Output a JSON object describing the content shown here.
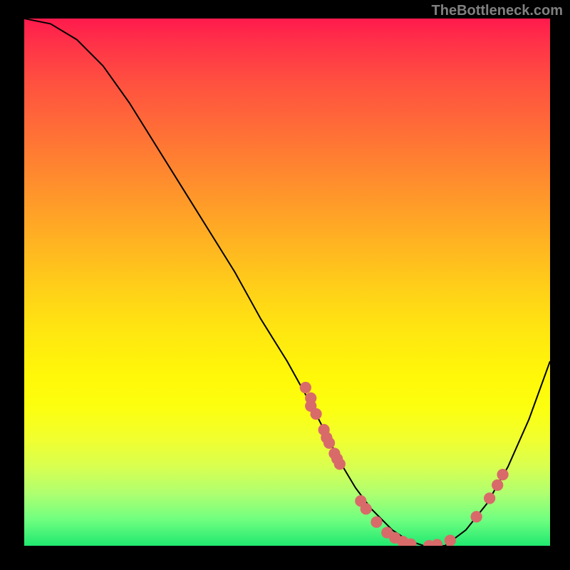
{
  "watermark": "TheBottleneck.com",
  "chart_data": {
    "type": "line",
    "title": "",
    "xlabel": "",
    "ylabel": "",
    "xlim": [
      0,
      100
    ],
    "ylim": [
      0,
      100
    ],
    "series": [
      {
        "name": "curve",
        "x": [
          0,
          5,
          10,
          15,
          20,
          25,
          30,
          35,
          40,
          45,
          50,
          55,
          58,
          60,
          63,
          66,
          70,
          73,
          76,
          80,
          84,
          88,
          92,
          96,
          100
        ],
        "y": [
          100,
          99,
          96,
          91,
          84,
          76,
          68,
          60,
          52,
          43,
          35,
          26,
          20,
          16,
          11,
          7,
          3,
          1,
          0,
          0,
          3,
          8,
          15,
          24,
          35
        ]
      }
    ],
    "markers": [
      {
        "x": 53.5,
        "y": 30
      },
      {
        "x": 54.5,
        "y": 28
      },
      {
        "x": 54.5,
        "y": 26.5
      },
      {
        "x": 55.5,
        "y": 25
      },
      {
        "x": 57,
        "y": 22
      },
      {
        "x": 57.5,
        "y": 20.5
      },
      {
        "x": 58,
        "y": 19.5
      },
      {
        "x": 59,
        "y": 17.5
      },
      {
        "x": 59.5,
        "y": 16.5
      },
      {
        "x": 60,
        "y": 15.5
      },
      {
        "x": 64,
        "y": 8.5
      },
      {
        "x": 65,
        "y": 7
      },
      {
        "x": 67,
        "y": 4.5
      },
      {
        "x": 69,
        "y": 2.5
      },
      {
        "x": 70.5,
        "y": 1.5
      },
      {
        "x": 72,
        "y": 0.8
      },
      {
        "x": 73.5,
        "y": 0.3
      },
      {
        "x": 77,
        "y": 0
      },
      {
        "x": 78.5,
        "y": 0.2
      },
      {
        "x": 81,
        "y": 1
      },
      {
        "x": 86,
        "y": 5.5
      },
      {
        "x": 88.5,
        "y": 9
      },
      {
        "x": 90,
        "y": 11.5
      },
      {
        "x": 91,
        "y": 13.5
      }
    ],
    "marker_color": "#d96a6a",
    "curve_color": "#000000"
  }
}
